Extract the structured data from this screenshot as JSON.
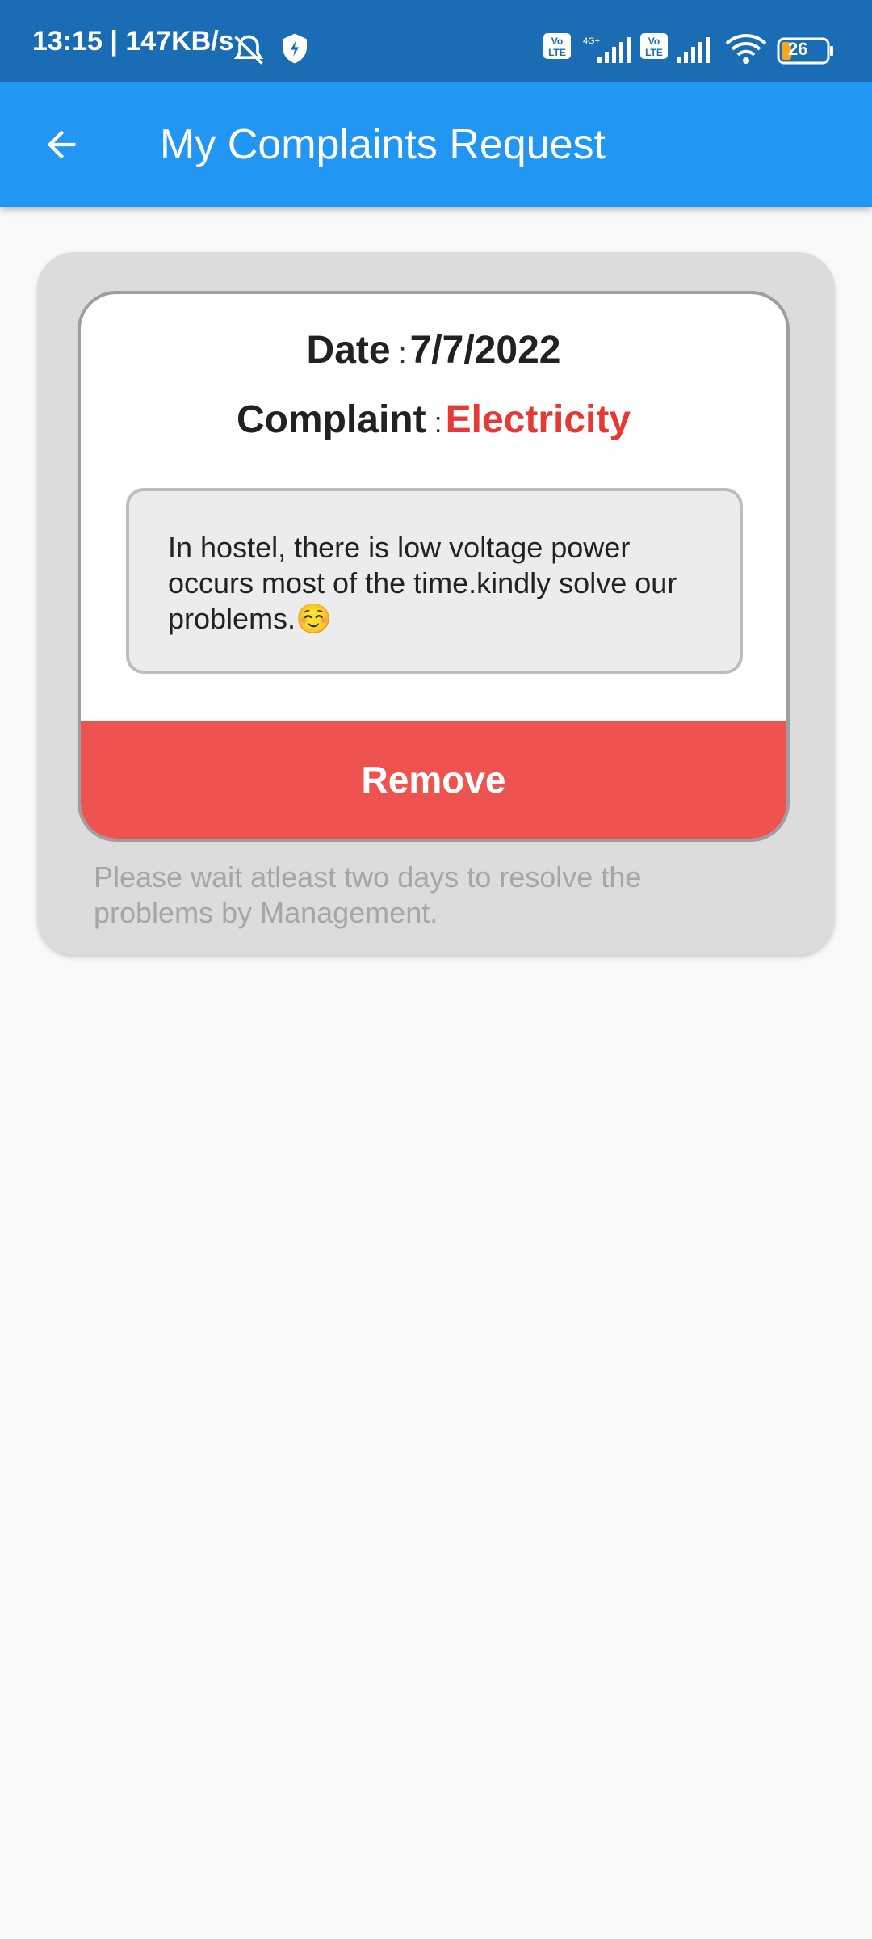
{
  "status_bar": {
    "time": "13:15 | 147KB/s",
    "battery": "26",
    "network_label": "4G+"
  },
  "app_bar": {
    "title": "My Complaints Request",
    "back_icon": "arrow-left-icon"
  },
  "complaint": {
    "date_label": "Date",
    "separator": ":",
    "date_value": "7/7/2022",
    "complaint_label": "Complaint",
    "complaint_value": "Electricity",
    "description": "In hostel, there is low voltage power occurs most of the time.kindly solve our problems.☺️",
    "remove_label": "Remove"
  },
  "note": "Please wait atleast two days to resolve the problems by Management.",
  "colors": {
    "status_bar": "#1a6db5",
    "app_bar": "#2196f3",
    "remove": "#ef5350",
    "complaint_type": "#e53935"
  }
}
